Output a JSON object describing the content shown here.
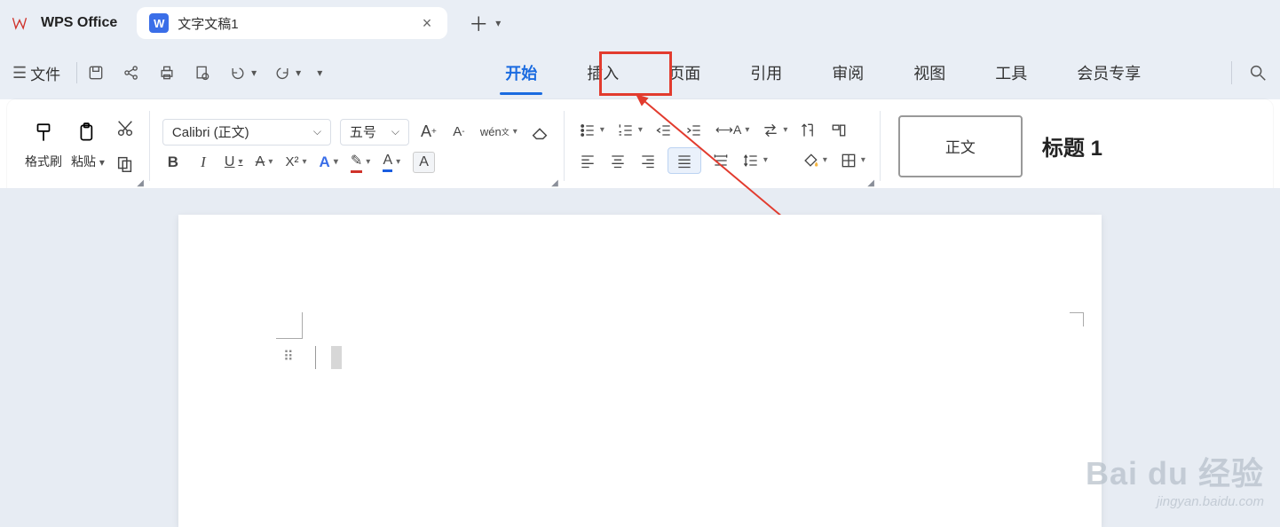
{
  "app": {
    "name": "WPS Office"
  },
  "document": {
    "title": "文字文稿1"
  },
  "menu": {
    "file": "文件",
    "tabs": [
      "开始",
      "插入",
      "页面",
      "引用",
      "审阅",
      "视图",
      "工具",
      "会员专享"
    ],
    "active_index": 0,
    "highlighted_index": 1
  },
  "ribbon": {
    "format_painter": "格式刷",
    "paste": "粘贴",
    "font_name": "Calibri (正文)",
    "font_size": "五号",
    "styles": {
      "normal": "正文",
      "heading1": "标题 1"
    }
  },
  "watermark": {
    "line1": "Bai du 经验",
    "line2": "jingyan.baidu.com"
  }
}
